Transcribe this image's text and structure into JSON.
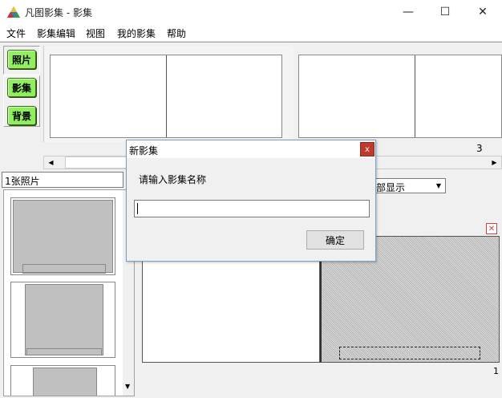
{
  "window": {
    "title": "凡图影集 - 影集",
    "controls": {
      "minimize": "—",
      "maximize": "☐",
      "close": "✕"
    }
  },
  "menu": [
    "文件",
    "影集编辑",
    "视图",
    "我的影集",
    "帮助"
  ],
  "sidebar": {
    "buttons": [
      "照片",
      "影集",
      "背景"
    ]
  },
  "filmstrip": {
    "counter": "3"
  },
  "photos_panel": {
    "count_label": "1张照片"
  },
  "view_select": {
    "selected": "部显示"
  },
  "page_number": "1",
  "dialog": {
    "title": "新影集",
    "prompt": "请输入影集名称",
    "input_value": "",
    "ok_label": "确定",
    "close_glyph": "x"
  },
  "colors": {
    "green_button": "#90ee60",
    "close_red": "#c0392b",
    "dialog_border": "#7aa0c8"
  }
}
